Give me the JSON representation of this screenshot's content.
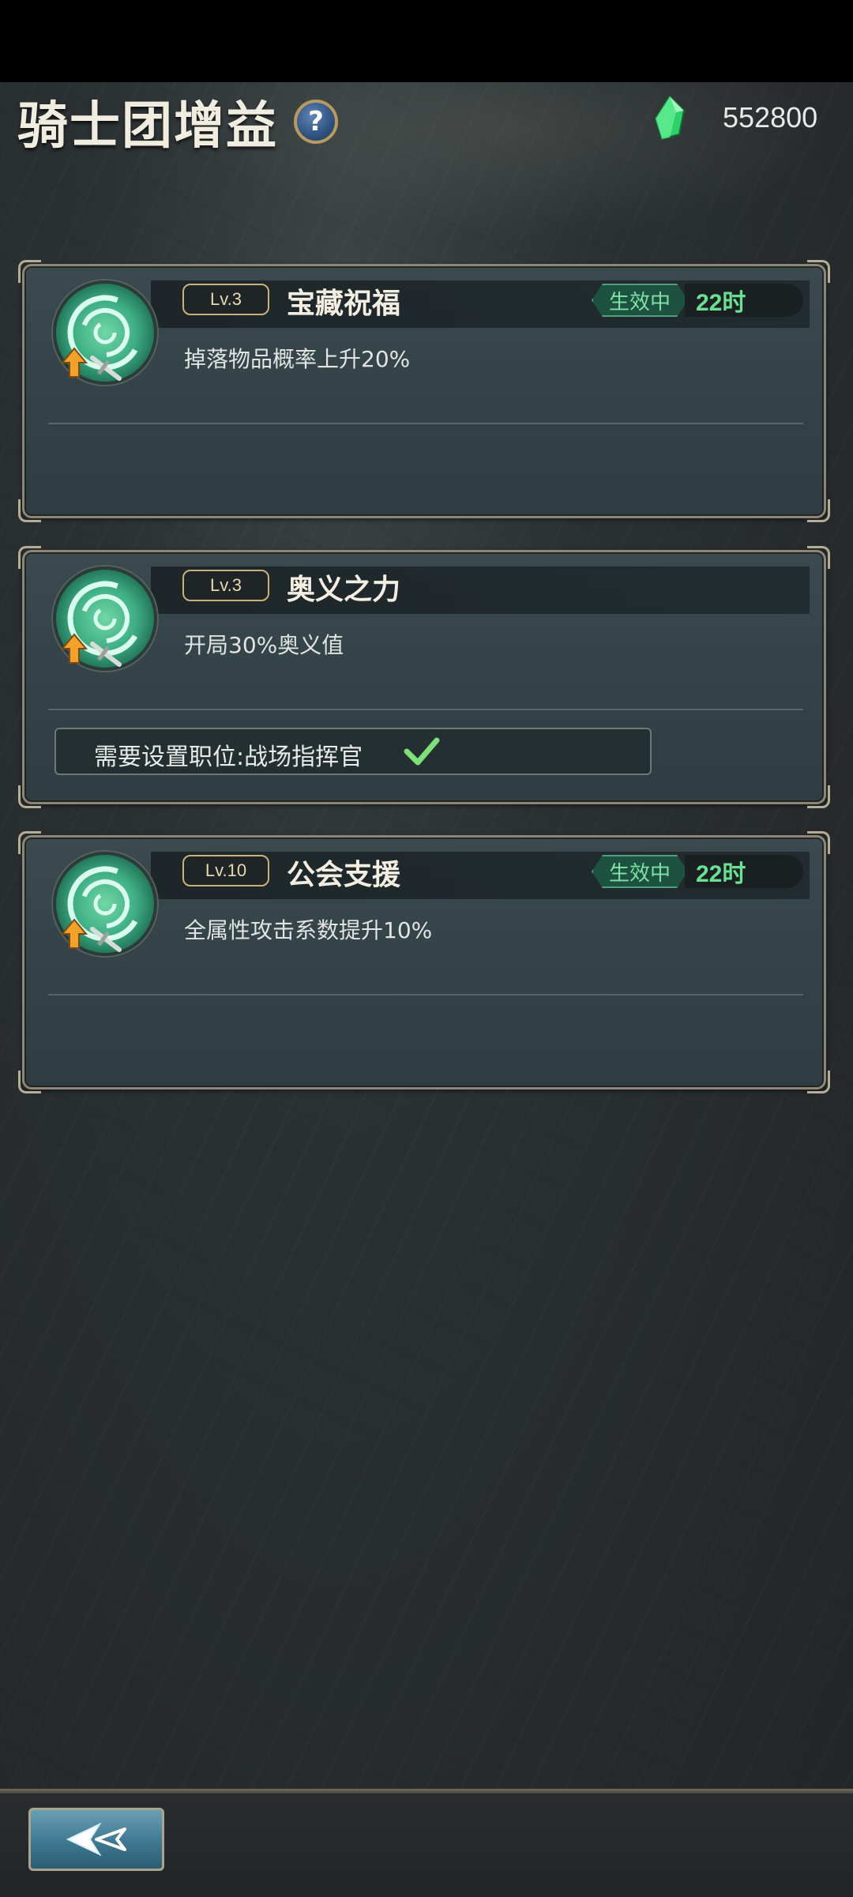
{
  "header": {
    "title": "骑士团增益",
    "help_icon": "question-mark-icon",
    "help_glyph": "?",
    "currency": {
      "icon": "green-gem-icon",
      "amount": "552800"
    }
  },
  "buffs": [
    {
      "level": "Lv.3",
      "name": "宝藏祝福",
      "description": "掉落物品概率上升20%",
      "status": "生效中",
      "time_left": "22时"
    },
    {
      "level": "Lv.3",
      "name": "奥义之力",
      "description": "开局30%奥义值",
      "requirement": "需要设置职位:战场指挥官"
    },
    {
      "level": "Lv.10",
      "name": "公会支援",
      "description": "全属性攻击系数提升10%",
      "status": "生效中",
      "time_left": "22时"
    }
  ],
  "footer": {
    "back_icon": "back-arrow-icon"
  },
  "colors": {
    "active": "#7fe0a8",
    "timer": "#6be092",
    "accent_gold": "#c9b27a"
  }
}
